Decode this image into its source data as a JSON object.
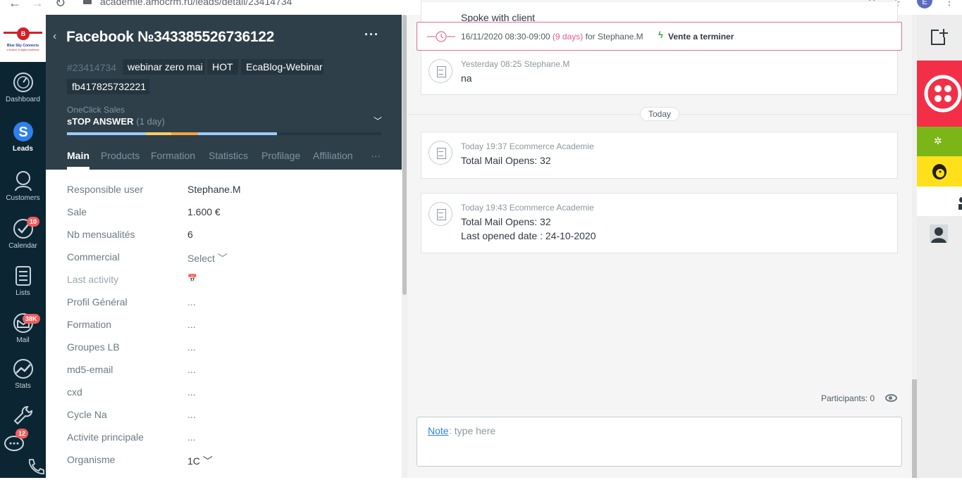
{
  "browser": {
    "url": "academie.amocrm.ru/leads/detail/23414734",
    "profile_initial": "E"
  },
  "logo": {
    "letter": "B",
    "name": "Blue Sky Connects",
    "tagline": "a division of digital excellence"
  },
  "leftnav": {
    "items": [
      {
        "label": "Dashboard",
        "icon": "dashboard-icon"
      },
      {
        "label": "Leads",
        "icon": "leads-dollar-icon",
        "active": true
      },
      {
        "label": "Customers",
        "icon": "customers-icon"
      },
      {
        "label": "Calendar",
        "icon": "calendar-check-icon",
        "badge": "10"
      },
      {
        "label": "Lists",
        "icon": "lists-icon"
      },
      {
        "label": "Mail",
        "icon": "mail-icon",
        "badge": "38K"
      },
      {
        "label": "Stats",
        "icon": "stats-icon"
      },
      {
        "label": "",
        "icon": "settings-wrench-icon"
      },
      {
        "label": "",
        "icon": "chat-icon",
        "badge": "12"
      },
      {
        "label": "",
        "icon": "phone-icon"
      }
    ]
  },
  "lead": {
    "title": "Facebook №343385526736122",
    "id": "#23414734",
    "tags": [
      "webinar zero mai",
      "HOT",
      "EcaBlog-Webinar",
      "fb417825732221"
    ],
    "pipeline": "OneClick Sales",
    "stage": "sTOP ANSWER",
    "stage_duration": "(1 day)",
    "progress_colors": [
      "#99ccff",
      "#ffcc66",
      "#ffcc66",
      "#99ccff"
    ],
    "tabs": [
      "Main",
      "Products",
      "Formation",
      "Statistics",
      "Profilage",
      "Affiliation",
      "···"
    ],
    "fields": [
      {
        "label": "Responsible user",
        "value": "Stephane.M"
      },
      {
        "label": "Sale",
        "value": "1.600 €"
      },
      {
        "label": "Nb mensualités",
        "value": "6"
      },
      {
        "label": "Commercial",
        "value": "Select ﹀"
      },
      {
        "label": "Last activity",
        "value": "📅"
      },
      {
        "label": "Profil Général",
        "value": "..."
      },
      {
        "label": "Formation",
        "value": "..."
      },
      {
        "label": "Groupes LB",
        "value": "..."
      },
      {
        "label": "md5-email",
        "value": "..."
      },
      {
        "label": "cxd",
        "value": "..."
      },
      {
        "label": "Cycle Na",
        "value": "..."
      },
      {
        "label": "Activite principale",
        "value": "..."
      },
      {
        "label": "Organisme",
        "value": "1C ﹀"
      }
    ]
  },
  "feed": {
    "top_partial_text": "Spoke with client",
    "task": {
      "date": "16/11/2020 08:30-09:00",
      "overdue": "(9 days)",
      "assignee": "for Stephane.M",
      "result": "Vente a terminer"
    },
    "notes_before": [
      {
        "meta": "Yesterday 08:25 Stephane.M",
        "lines": [
          "na"
        ]
      }
    ],
    "divider": "Today",
    "notes_today": [
      {
        "meta": "Today 19:37 Ecommerce Academie",
        "lines": [
          "Total Mail Opens: 32"
        ]
      },
      {
        "meta": "Today 19:43 Ecommerce Academie",
        "lines": [
          "Total Mail Opens: 32",
          "Last opened date : 24-10-2020"
        ]
      }
    ],
    "participants": "Participants: 0",
    "composer": {
      "type": "Note",
      "placeholder": ": type here"
    }
  },
  "widgets": [
    {
      "icon": "add-widget-icon",
      "bg": "#ededed"
    },
    {
      "icon": "twilio-icon",
      "bg": "#f22f46"
    },
    {
      "icon": "gear-widget-icon",
      "bg": "#7cb518"
    },
    {
      "icon": "mailchimp-icon",
      "bg": "#ffe01b"
    },
    {
      "icon": "user-widget-icon",
      "bg": "#ffffff"
    },
    {
      "icon": "user-avatar-icon",
      "bg": "#ededed"
    }
  ]
}
